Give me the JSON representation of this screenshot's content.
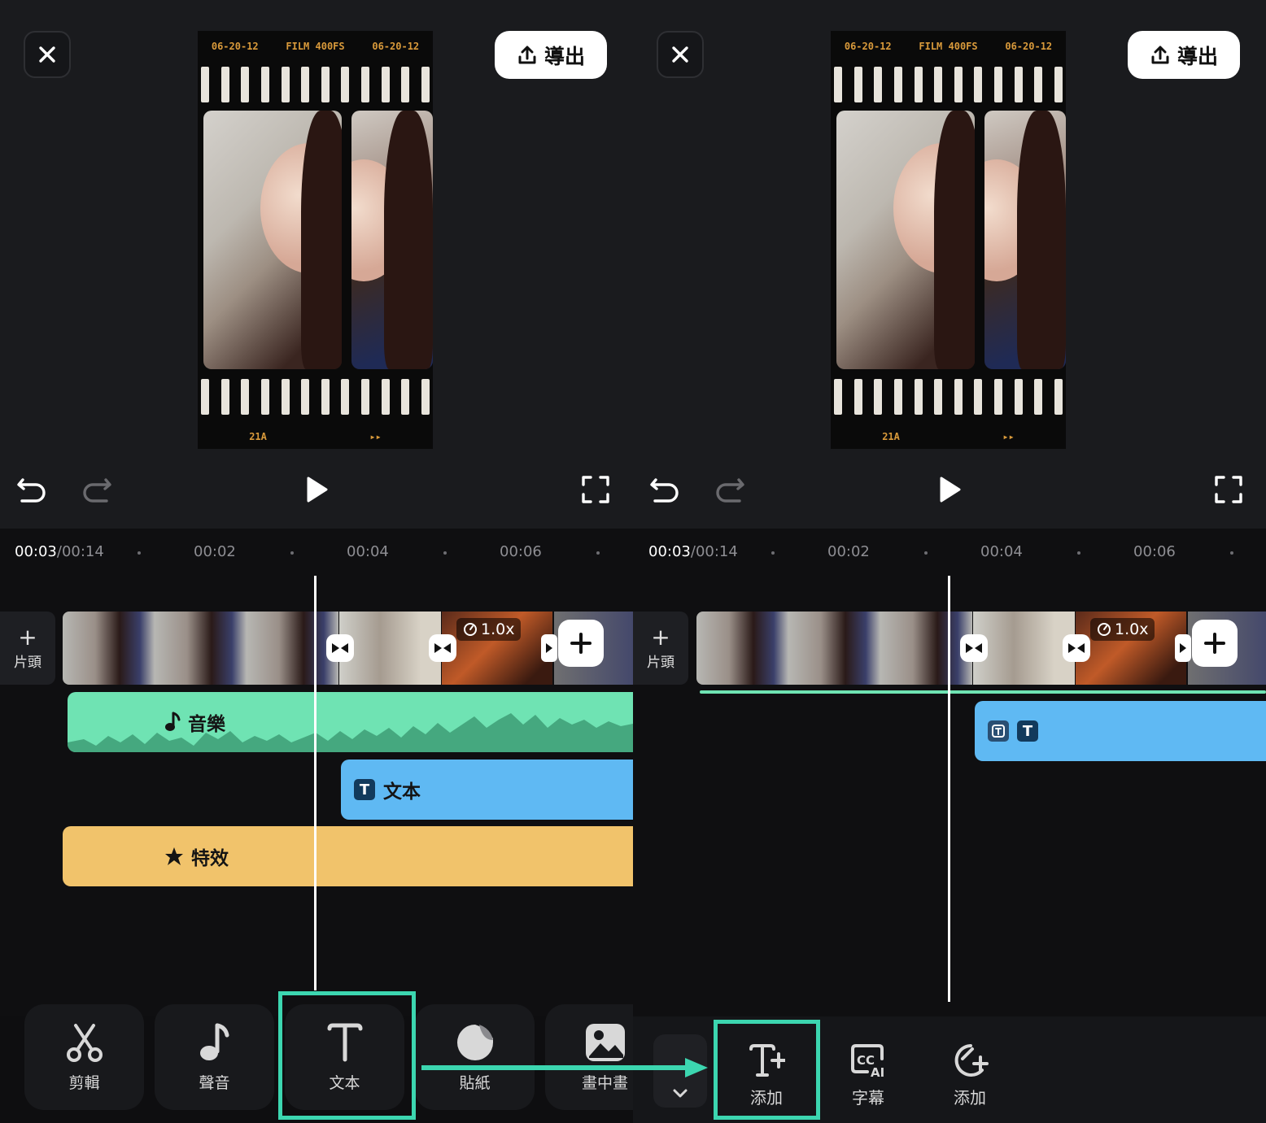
{
  "left": {
    "export_label": "導出",
    "preview": {
      "film_top": [
        "06-20-12",
        "FILM 400FS",
        "06-20-12"
      ],
      "film_bottom": [
        "21A",
        "▸▸"
      ]
    },
    "ruler": {
      "current": "00:03",
      "total": "/00:14",
      "ticks": [
        "00:02",
        "00:04",
        "00:06"
      ]
    },
    "intro_label": "片頭",
    "speed_badge": "1.0x",
    "tracks": {
      "music": "音樂",
      "text": "文本",
      "effect": "特效"
    },
    "toolbar": [
      {
        "label": "剪輯",
        "icon": "scissors-icon"
      },
      {
        "label": "聲音",
        "icon": "music-note-icon"
      },
      {
        "label": "文本",
        "icon": "text-icon"
      },
      {
        "label": "貼紙",
        "icon": "sticker-icon"
      },
      {
        "label": "畫中畫",
        "icon": "picture-in-picture-icon"
      }
    ]
  },
  "right": {
    "export_label": "導出",
    "preview": {
      "film_top": [
        "06-20-12",
        "FILM 400FS",
        "06-20-12"
      ],
      "film_bottom": [
        "21A",
        "▸▸"
      ]
    },
    "ruler": {
      "current": "00:03",
      "total": "/00:14",
      "ticks": [
        "00:02",
        "00:04",
        "00:06"
      ]
    },
    "intro_label": "片頭",
    "speed_badge": "1.0x",
    "subtools": [
      {
        "label": "添加",
        "icon": "add-text-icon"
      },
      {
        "label": "字幕",
        "icon": "ai-caption-icon"
      },
      {
        "label": "添加",
        "icon": "add-template-icon"
      }
    ]
  },
  "colors": {
    "accent_highlight": "#3cd6b0",
    "music_track": "#6fe3b3",
    "text_track": "#5fb9f3",
    "effect_track": "#f1c36b"
  }
}
